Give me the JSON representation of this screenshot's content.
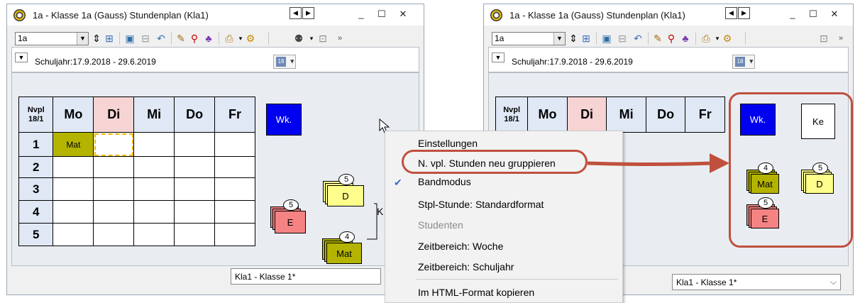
{
  "left_window": {
    "title": "1a - Klasse 1a (Gauss) Stundenplan (Kla1)",
    "class_select": "1a",
    "schuljahr": "Schuljahr:17.9.2018 - 29.6.2019",
    "grid": {
      "corner_line1": "Nvpl",
      "corner_line2": "18/1",
      "days": [
        "Mo",
        "Di",
        "Mi",
        "Do",
        "Fr"
      ],
      "periods": [
        "1",
        "2",
        "3",
        "4",
        "5"
      ],
      "cell_mo_1": "Mat"
    },
    "wk_label": "Wk.",
    "cards": [
      {
        "label": "D",
        "count": "5",
        "color": "#fdfd8c"
      },
      {
        "label": "E",
        "count": "5",
        "color": "#f58383"
      },
      {
        "label": "Mat",
        "count": "4",
        "color": "#b4b400"
      }
    ],
    "partial_label": "K",
    "footer_select": "Kla1 - Klasse 1*"
  },
  "right_window": {
    "title": "1a - Klasse 1a (Gauss) Stundenplan (Kla1)",
    "class_select": "1a",
    "schuljahr": "Schuljahr:17.9.2018 - 29.6.2019",
    "grid": {
      "corner_line1": "Nvpl",
      "corner_line2": "18/1",
      "days": [
        "Mo",
        "Di",
        "Mi",
        "Do",
        "Fr"
      ],
      "periods": [
        "1",
        "2",
        "3",
        "4",
        "5"
      ]
    },
    "wk_label": "Wk.",
    "ke_label": "Ke",
    "cards": [
      {
        "label": "Mat",
        "count": "4",
        "color": "#b4b400"
      },
      {
        "label": "D",
        "count": "5",
        "color": "#fdfd8c"
      },
      {
        "label": "E",
        "count": "5",
        "color": "#f58383"
      }
    ],
    "footer_select": "Kla1 - Klasse 1*"
  },
  "context_menu": {
    "items": [
      "Einstellungen",
      "N. vpl. Stunden neu gruppieren",
      "Bandmodus",
      "Stpl-Stunde: Standardformat",
      "Studenten",
      "Zeitbereich: Woche",
      "Zeitbereich: Schuljahr",
      "Im HTML-Format kopieren"
    ],
    "checked_item": "Bandmodus",
    "disabled_item": "Studenten"
  },
  "colors": {
    "wk_blue": "#0000f0",
    "highlight_ring": "#c0503e",
    "arrow": "#c0503e"
  }
}
